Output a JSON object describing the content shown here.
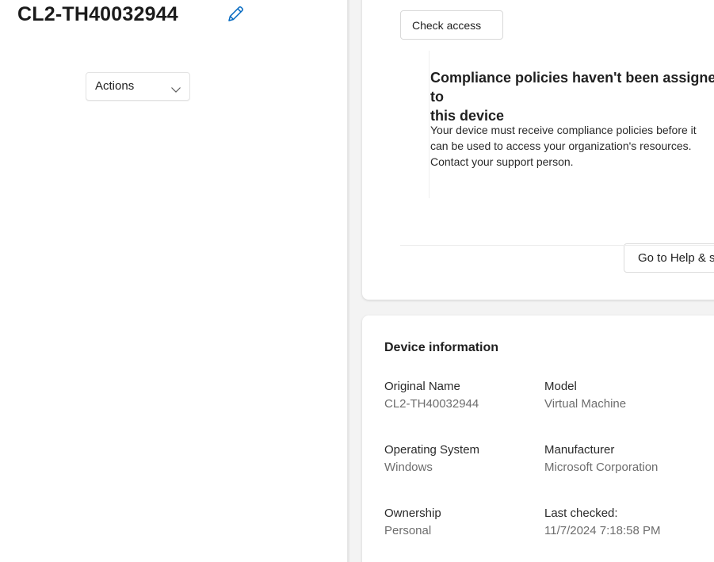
{
  "device": {
    "title": "CL2-TH40032944",
    "edit_icon": "pencil-icon"
  },
  "actions": {
    "label": "Actions",
    "chevron_icon": "chevron-down-icon"
  },
  "compliance": {
    "check_access_label": "Check access",
    "notice_title_line1": "Compliance policies haven't been assigned to",
    "notice_title_line2": "this device",
    "notice_body_line1": "Your device must receive compliance policies before it",
    "notice_body_line2": "can be used to access your organization's resources.",
    "notice_body_line3": "Contact your support person.",
    "help_button_label": "Go to Help & support"
  },
  "device_info": {
    "header": "Device information",
    "fields": [
      {
        "label": "Original Name",
        "value": "CL2-TH40032944"
      },
      {
        "label": "Model",
        "value": "Virtual Machine"
      },
      {
        "label": "Operating System",
        "value": "Windows"
      },
      {
        "label": "Manufacturer",
        "value": "Microsoft Corporation"
      },
      {
        "label": "Ownership",
        "value": "Personal"
      },
      {
        "label": "Last checked:",
        "value": "11/7/2024 7:18:58 PM"
      }
    ]
  },
  "colors": {
    "accent": "#0067c0",
    "pane_background": "#f3f3f3",
    "secondary_text": "#6d6d6d"
  }
}
